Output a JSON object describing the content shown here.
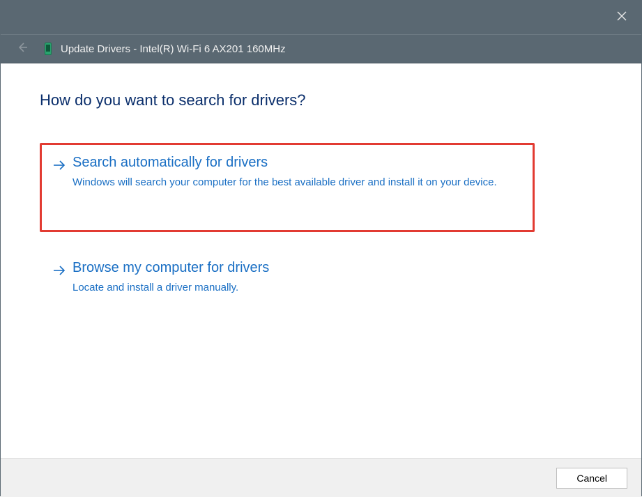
{
  "titlebar": {
    "close_label": "Close"
  },
  "header": {
    "title": "Update Drivers - Intel(R) Wi-Fi 6 AX201 160MHz"
  },
  "content": {
    "heading": "How do you want to search for drivers?",
    "options": [
      {
        "title": "Search automatically for drivers",
        "desc": "Windows will search your computer for the best available driver and install it on your device.",
        "highlighted": true
      },
      {
        "title": "Browse my computer for drivers",
        "desc": "Locate and install a driver manually.",
        "highlighted": false
      }
    ]
  },
  "footer": {
    "cancel_label": "Cancel"
  },
  "colors": {
    "titlebar_bg": "#5a6872",
    "link_blue": "#1a6fc4",
    "heading_navy": "#0a2e6b",
    "highlight_red": "#e23b32"
  }
}
